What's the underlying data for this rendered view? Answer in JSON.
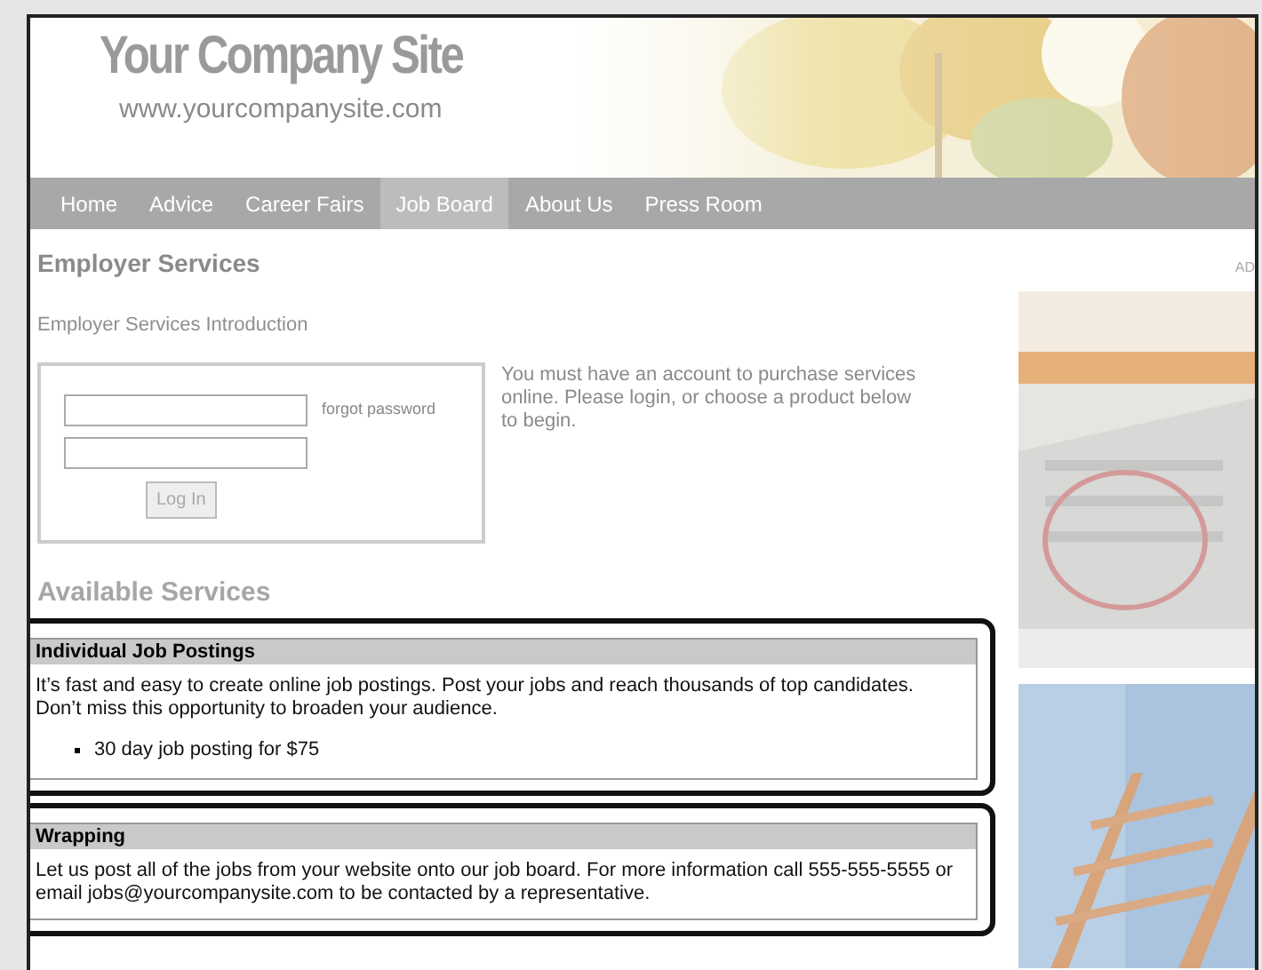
{
  "site": {
    "title": "Your Company Site",
    "url": "www.yourcompanysite.com"
  },
  "nav": [
    {
      "label": "Home",
      "selected": false
    },
    {
      "label": "Advice",
      "selected": false
    },
    {
      "label": "Career Fairs",
      "selected": false
    },
    {
      "label": "Job Board",
      "selected": true
    },
    {
      "label": "About Us",
      "selected": false
    },
    {
      "label": "Press Room",
      "selected": false
    }
  ],
  "page": {
    "heading": "Employer Services",
    "intro": "Employer Services Introduction"
  },
  "login": {
    "forgot_link": "forgot password",
    "button": "Log In",
    "note": "You must have an account to purchase services online. Please login, or choose a product below to begin."
  },
  "services_heading": "Available Services",
  "services": [
    {
      "title": "Individual Job Postings",
      "description": "It’s fast and easy to create online job postings. Post your jobs and reach thousands of top candidates. Don’t miss this opportunity to broaden your audience.",
      "bullets": [
        "30 day job posting for $75"
      ]
    },
    {
      "title": "Wrapping",
      "description": "Let us post all of the jobs from your website onto our job board. For more information call 555-555-5555 or email jobs@yourcompanysite.com to be contacted by a representative."
    }
  ],
  "ad_label": "AD"
}
